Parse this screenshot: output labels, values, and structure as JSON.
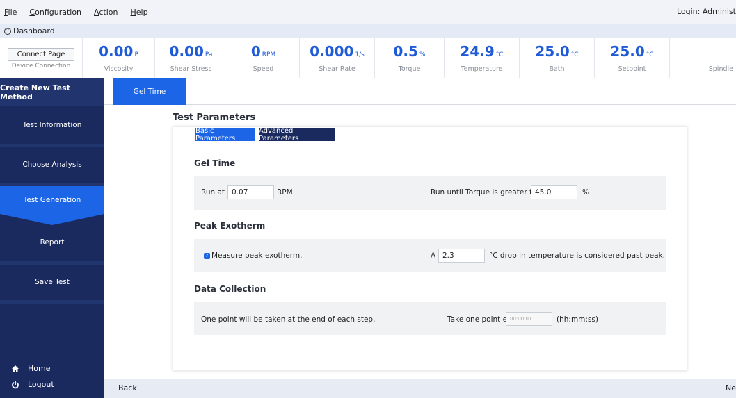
{
  "menu": [
    {
      "label": "File",
      "hotkey": "F"
    },
    {
      "label": "Configuration",
      "hotkey": "C"
    },
    {
      "label": "Action",
      "hotkey": "A"
    },
    {
      "label": "Help",
      "hotkey": "H"
    }
  ],
  "login": "Login: Administ",
  "dashboard": {
    "label": "Dashboard"
  },
  "connect": {
    "button": "Connect Page",
    "sub": "Device Connection"
  },
  "readings": [
    {
      "value": "0.00",
      "unit": "P",
      "label": "Viscosity"
    },
    {
      "value": "0.00",
      "unit": "Pa",
      "label": "Shear Stress"
    },
    {
      "value": "0",
      "unit": "RPM",
      "label": "Speed"
    },
    {
      "value": "0.000",
      "unit": "1/s",
      "label": "Shear Rate"
    },
    {
      "value": "0.5",
      "unit": "%",
      "label": "Torque"
    },
    {
      "value": "24.9",
      "unit": "°C",
      "label": "Temperature"
    },
    {
      "value": "25.0",
      "unit": "°C",
      "label": "Bath"
    },
    {
      "value": "25.0",
      "unit": "°C",
      "label": "Setpoint"
    },
    {
      "value": "",
      "unit": "",
      "label": "Spindle"
    }
  ],
  "sidebar": {
    "header": "Create New Test Method",
    "items": [
      {
        "label": "Test Information"
      },
      {
        "label": "Choose Analysis"
      },
      {
        "label": "Test Generation",
        "active": true
      },
      {
        "label": "Report"
      },
      {
        "label": "Save Test"
      }
    ],
    "home": "Home",
    "logout": "Logout"
  },
  "tabs": {
    "gel_time": "Gel Time"
  },
  "test_parameters": {
    "title": "Test Parameters",
    "basic_tab": "Basic Parameters",
    "advanced_tab": "Advanced Parameters",
    "gel_time": {
      "title": "Gel Time",
      "run_at_label": "Run at",
      "run_at_value": "0.07",
      "run_at_unit": "RPM",
      "torque_label": "Run until Torque is greater than",
      "torque_value": "45.0",
      "torque_unit": "%"
    },
    "peak_exotherm": {
      "title": "Peak Exotherm",
      "measure_label": "Measure peak exotherm.",
      "measure_checked": true,
      "drop_prefix": "A",
      "drop_value": "2.3",
      "drop_suffix": "°C drop in temperature is considered past peak."
    },
    "data_collection": {
      "title": "Data Collection",
      "note": "One point will be taken at the end of each step.",
      "interval_label": "Take one point every",
      "interval_value": "00:00:01",
      "interval_unit": "(hh:mm:ss)"
    }
  },
  "footer": {
    "back": "Back",
    "next": "Ne"
  },
  "colors": {
    "accent": "#1c65e6",
    "sidebar": "#1a2a5e",
    "reading": "#1f5bd6"
  }
}
